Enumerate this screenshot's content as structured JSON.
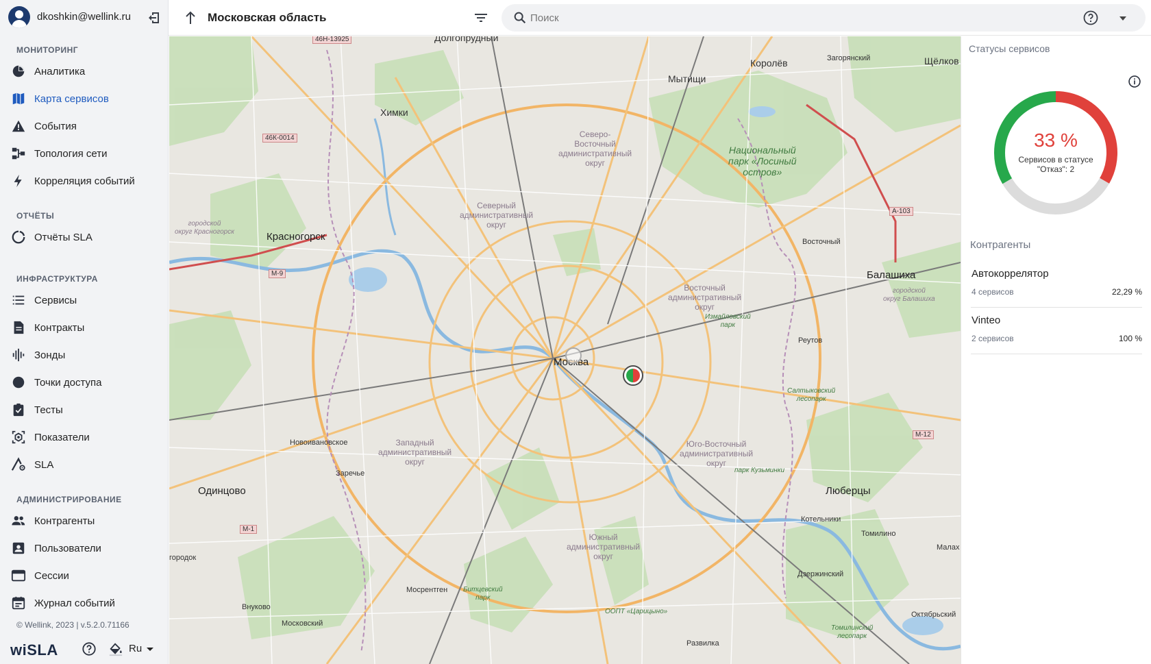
{
  "user": {
    "email": "dkoshkin@wellink.ru"
  },
  "sidebar": {
    "sections": [
      {
        "title": "МОНИТОРИНГ",
        "items": [
          {
            "label": "Аналитика",
            "icon": "chart-pie-icon"
          },
          {
            "label": "Карта сервисов",
            "icon": "map-icon",
            "active": true
          },
          {
            "label": "События",
            "icon": "warning-icon"
          },
          {
            "label": "Топология сети",
            "icon": "topology-icon"
          },
          {
            "label": "Корреляция событий",
            "icon": "lightning-icon"
          }
        ]
      },
      {
        "title": "ОТЧЁТЫ",
        "items": [
          {
            "label": "Отчёты SLA",
            "icon": "report-circle-icon"
          }
        ]
      },
      {
        "title": "ИНФРАСТРУКТУРА",
        "items": [
          {
            "label": "Сервисы",
            "icon": "list-icon"
          },
          {
            "label": "Контракты",
            "icon": "document-icon"
          },
          {
            "label": "Зонды",
            "icon": "probe-bars-icon"
          },
          {
            "label": "Точки доступа",
            "icon": "dot-icon"
          },
          {
            "label": "Тесты",
            "icon": "clipboard-check-icon"
          },
          {
            "label": "Показатели",
            "icon": "metrics-icon"
          },
          {
            "label": "SLA",
            "icon": "sla-chart-icon"
          }
        ]
      },
      {
        "title": "АДМИНИСТРИРОВАНИЕ",
        "items": [
          {
            "label": "Контрагенты",
            "icon": "people-icon"
          },
          {
            "label": "Пользователи",
            "icon": "user-card-icon"
          },
          {
            "label": "Сессии",
            "icon": "window-icon"
          },
          {
            "label": "Журнал событий",
            "icon": "calendar-icon"
          }
        ]
      }
    ],
    "footer": {
      "copyright": "© Wellink, 2023 | v.5.2.0.71166",
      "logo": "wiSLA",
      "language": "Ru"
    }
  },
  "topbar": {
    "region": "Московская область",
    "search_placeholder": "Поиск"
  },
  "map": {
    "labels": {
      "dolgoprudny": "Долгопрудный",
      "khimki": "Химки",
      "mytishchi": "Мытищи",
      "korolev": "Королёв",
      "zagoryansky": "Загорянский",
      "shchelkovo": "Щёлков",
      "krasnogorsk": "Красногорск",
      "moskva": "Москва",
      "balashikha": "Балашиха",
      "vostochny": "Восточный",
      "reutov": "Реутов",
      "novoivanovskoe": "Новоивановское",
      "zarechye": "Заречье",
      "odintsovo": "Одинцово",
      "lyubertsy": "Люберцы",
      "kotelniki": "Котельники",
      "tomilino": "Томилино",
      "dzerzhinsky": "Дзержинский",
      "mosrentgen": "Мосрентген",
      "vnukovo": "Внуково",
      "moskovsky": "Московский",
      "razvilka": "Развилка",
      "oktyabrsky": "Октябрьский",
      "malakh": "Малах",
      "gorodok": "городок",
      "d_svao": "Северо-\nВосточный\nадминистративный\nокруг",
      "d_sao": "Северный\nадминистративный\nокруг",
      "d_vao": "Восточный\nадминистративный\nокруг",
      "d_zao": "Западный\nадминистративный\nокруг",
      "d_uvao": "Юго-Восточный\nадминистративный\nокруг",
      "d_uao": "Южный\nадминистративный\nокруг",
      "losiny": "Национальный\nпарк «Лосиный\nостров»",
      "izmailovsky": "Измайловский\nпарк",
      "kuzminki": "парк Кузьминки",
      "saltykovsky": "Салтыковский\nлесопарк",
      "tsaritsyno": "ООПТ «Царицыно»",
      "bitsevsky": "Битцевский\nпарк",
      "tomilinsky": "Томилинский\nлесопарк",
      "balashikha_small": "городской\nокруг Балашиха",
      "krasnogorsk_small": "городской\nокруг Красногорск",
      "road_46h": "46Н-13925",
      "road_46k": "46К-0014",
      "road_m9": "М-9",
      "road_m1": "М-1",
      "road_a103": "А-103",
      "road_m12": "М-12"
    }
  },
  "panel": {
    "title": "Статусы сервисов",
    "donut": {
      "percent_label": "33 %",
      "caption": "Сервисов в статусе \"Отказ\": 2",
      "segments": [
        {
          "status": "fail",
          "fraction": 0.333,
          "color": "#e0413b"
        },
        {
          "status": "unknown",
          "fraction": 0.333,
          "color": "#dcdcdc"
        },
        {
          "status": "ok",
          "fraction": 0.334,
          "color": "#27a84b"
        }
      ]
    },
    "contractors_title": "Контрагенты",
    "contractors": [
      {
        "name": "Автокоррелятор",
        "count": "4 сервисов",
        "percent": "22,29 %"
      },
      {
        "name": "Vinteo",
        "count": "2 сервисов",
        "percent": "100 %"
      }
    ]
  }
}
